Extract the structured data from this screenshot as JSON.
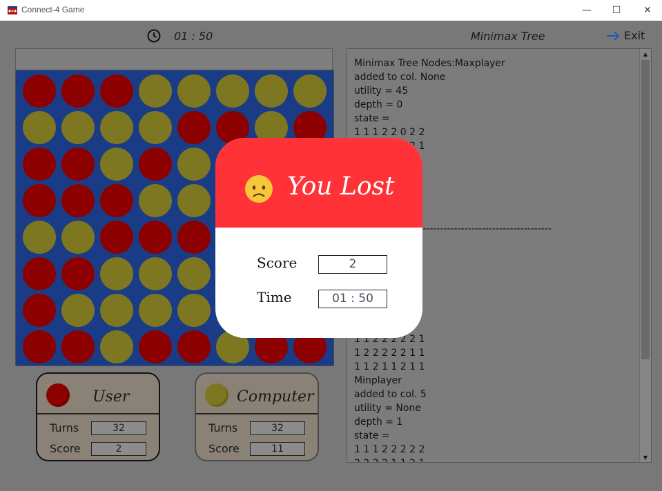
{
  "window": {
    "title": "Connect-4 Game",
    "minimize_glyph": "—",
    "maximize_glyph": "☐",
    "close_glyph": "✕"
  },
  "header": {
    "timer": "01 : 50",
    "tree_title": "Minimax Tree",
    "exit_label": "Exit"
  },
  "board": {
    "rows": 8,
    "cols": 8,
    "cells": [
      [
        "r",
        "r",
        "r",
        "y",
        "y",
        "y",
        "y",
        "y"
      ],
      [
        "y",
        "y",
        "y",
        "y",
        "r",
        "r",
        "y",
        "r"
      ],
      [
        "r",
        "r",
        "y",
        "r",
        "y",
        "r",
        "r",
        "r"
      ],
      [
        "r",
        "r",
        "r",
        "y",
        "y",
        "r",
        "r",
        "r"
      ],
      [
        "y",
        "y",
        "r",
        "r",
        "r",
        "r",
        "r",
        "r"
      ],
      [
        "r",
        "r",
        "y",
        "y",
        "y",
        "r",
        "r",
        "r"
      ],
      [
        "r",
        "y",
        "y",
        "y",
        "y",
        "r",
        "r",
        "r"
      ],
      [
        "r",
        "r",
        "y",
        "r",
        "r",
        "y",
        "r",
        "r"
      ]
    ],
    "colors": {
      "red": "#8c0000",
      "yellow": "#7e7721",
      "background": "#1a3c86"
    }
  },
  "tree_text": {
    "lines": [
      "Minimax Tree Nodes:Maxplayer",
      "added to col. None",
      "utility = 45",
      "depth = 0",
      "state =",
      "1 1 1 2 2 0 2 2",
      "1 1 1 2 2 2 2 1",
      "",
      "",
      "",
      "",
      "",
      "                    ---------------------------------------",
      "",
      "",
      "",
      "",
      "",
      "",
      "",
      "1 1 2 2 2 2 2 1",
      "1 2 2 2 2 2 1 1",
      "1 1 2 1 1 2 1 1",
      "Minplayer",
      "added to col. 5",
      "utility = None",
      "depth = 1",
      "state =",
      "1 1 1 2 2 2 2 2",
      "2 2 2 2 1 1 2 1"
    ]
  },
  "user_card": {
    "name": "User",
    "turns_label": "Turns",
    "turns_value": "32",
    "score_label": "Score",
    "score_value": "2"
  },
  "computer_card": {
    "name": "Computer",
    "turns_label": "Turns",
    "turns_value": "32",
    "score_label": "Score",
    "score_value": "11"
  },
  "result_dialog": {
    "title": "You Lost",
    "score_label": "Score",
    "score_value": "2",
    "time_label": "Time",
    "time_value": "01 : 50",
    "header_color": "#fe3237"
  }
}
